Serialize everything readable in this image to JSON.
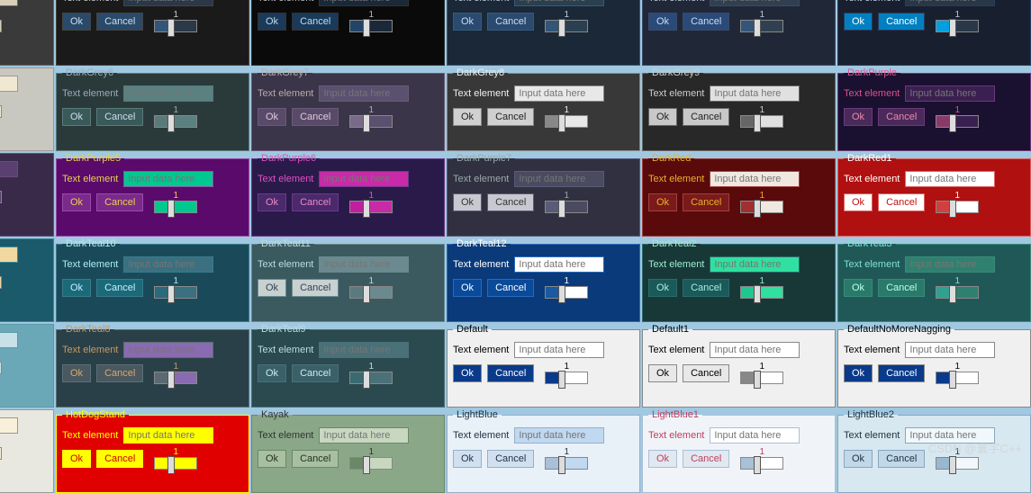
{
  "common": {
    "ok": "Ok",
    "cancel": "Cancel",
    "text_element": "Text element",
    "placeholder": "Input data here",
    "slider_value": "1"
  },
  "watermark": "CSDN @寰宇C++",
  "themes": [
    {
      "name": "",
      "bg": "#3a3a3a",
      "fg": "#ddd",
      "accent": "#0a0",
      "input_bg": "#d8d0b8",
      "input_fg": "#333",
      "btn_bg": "#555",
      "btn_fg": "#fff",
      "border": "#666"
    },
    {
      "name": "",
      "bg": "#1a1a1a",
      "fg": "#ccc",
      "accent": "#357",
      "input_bg": "#2a3848",
      "input_fg": "#aaccee",
      "btn_bg": "#2a4a6a",
      "btn_fg": "#cde",
      "border": "#444"
    },
    {
      "name": "",
      "bg": "#0a0a0a",
      "fg": "#bbb",
      "accent": "#246",
      "input_bg": "#1a2838",
      "input_fg": "#9bd",
      "btn_bg": "#1a3a5a",
      "btn_fg": "#bde",
      "border": "#333"
    },
    {
      "name": "",
      "bg": "#1a2838",
      "fg": "#bcd",
      "accent": "#357",
      "input_bg": "#2a4050",
      "input_fg": "#7ab0d8",
      "btn_bg": "#2a4a70",
      "btn_fg": "#cde",
      "border": "#3a5a7a"
    },
    {
      "name": "",
      "bg": "#202838",
      "fg": "#bcd",
      "accent": "#357",
      "input_bg": "#304050",
      "input_fg": "#9bd",
      "btn_bg": "#2a4a7a",
      "btn_fg": "#cde",
      "border": "#3a4a6a"
    },
    {
      "name": "",
      "bg": "#182030",
      "fg": "#bcd",
      "accent": "#00a0e0",
      "input_bg": "#283848",
      "input_fg": "#9bd",
      "btn_bg": "#0080c0",
      "btn_fg": "#fff",
      "border": "#2a3a5a"
    },
    {
      "name": "",
      "bg": "#c8c8c0",
      "fg": "#333",
      "accent": "#888",
      "input_bg": "#f0e8d0",
      "input_fg": "#333",
      "btn_bg": "#d8d8d0",
      "btn_fg": "#333",
      "border": "#999"
    },
    {
      "name": "DarkGrey6",
      "bg": "#2a3a3a",
      "fg": "#9ab",
      "accent": "#5a7a7a",
      "input_bg": "#5a8080",
      "input_fg": "#cde",
      "btn_bg": "#3a5a5a",
      "btn_fg": "#cde",
      "border": "#5a7a7a"
    },
    {
      "name": "DarkGrey7",
      "bg": "#3a3548",
      "fg": "#baa",
      "accent": "#7a6a8a",
      "input_bg": "#5a5070",
      "input_fg": "#dcd",
      "btn_bg": "#5a4a6a",
      "btn_fg": "#dcd",
      "border": "#6a5a7a"
    },
    {
      "name": "DarkGrey8",
      "bg": "#383838",
      "fg": "#eee",
      "accent": "#888",
      "input_bg": "#e8e8e8",
      "input_fg": "#222",
      "btn_bg": "#d0d0d0",
      "btn_fg": "#222",
      "border": "#888"
    },
    {
      "name": "DarkGrey9",
      "bg": "#282828",
      "fg": "#ccc",
      "accent": "#666",
      "input_bg": "#e0e0e0",
      "input_fg": "#222",
      "btn_bg": "#c8c8c8",
      "btn_fg": "#222",
      "border": "#666"
    },
    {
      "name": "DarkPurple",
      "bg": "#1a1030",
      "fg": "#e05090",
      "accent": "#8a3a6a",
      "input_bg": "#3a2050",
      "input_fg": "#d898c0",
      "btn_bg": "#4a2a5a",
      "btn_fg": "#e8a",
      "border": "#6a3a7a"
    },
    {
      "name": "",
      "bg": "#3a2a4a",
      "fg": "#cbd",
      "accent": "#7a5a8a",
      "input_bg": "#5a4070",
      "input_fg": "#dcd",
      "btn_bg": "#5a3a6a",
      "btn_fg": "#dcd",
      "border": "#6a4a7a"
    },
    {
      "name": "DarkPurple5",
      "bg": "#5a0a6a",
      "fg": "#e8d050",
      "accent": "#00c890",
      "input_bg": "#00c890",
      "input_fg": "#003020",
      "btn_bg": "#7a2a8a",
      "btn_fg": "#e8d050",
      "border": "#9a4aaa"
    },
    {
      "name": "DarkPurple6",
      "bg": "#2a1a4a",
      "fg": "#e050c0",
      "accent": "#c020a0",
      "input_bg": "#c82aa8",
      "input_fg": "#fce",
      "btn_bg": "#4a2a6a",
      "btn_fg": "#e8c",
      "border": "#6a3a8a"
    },
    {
      "name": "DarkPurple7",
      "bg": "#303040",
      "fg": "#9aa",
      "accent": "#5a5a7a",
      "input_bg": "#4a4a60",
      "input_fg": "#bcd",
      "btn_bg": "#c8c8d0",
      "btn_fg": "#333",
      "border": "#5a5a7a"
    },
    {
      "name": "DarkRed",
      "bg": "#5a0a0a",
      "fg": "#e8b030",
      "accent": "#a03030",
      "input_bg": "#f0e8e0",
      "input_fg": "#402",
      "btn_bg": "#7a1a1a",
      "btn_fg": "#e8b030",
      "border": "#a04040"
    },
    {
      "name": "DarkRed1",
      "bg": "#b01010",
      "fg": "#fff",
      "accent": "#d04040",
      "input_bg": "#fff",
      "input_fg": "#b01010",
      "btn_bg": "#fff",
      "btn_fg": "#c01010",
      "border": "#e06060"
    },
    {
      "name": "",
      "bg": "#1a5a6a",
      "fg": "#cef",
      "accent": "#2a7a8a",
      "input_bg": "#f0d8a0",
      "input_fg": "#332",
      "btn_bg": "#2a7a8a",
      "btn_fg": "#cef",
      "border": "#3a8a9a"
    },
    {
      "name": "DarkTeal10",
      "bg": "#1a4a5a",
      "fg": "#aee",
      "accent": "#2a6a7a",
      "input_bg": "#3a7080",
      "input_fg": "#cef",
      "btn_bg": "#1a6a7a",
      "btn_fg": "#cef",
      "border": "#3a7a8a"
    },
    {
      "name": "DarkTeal11",
      "bg": "#3a5a60",
      "fg": "#bdd",
      "accent": "#5a7a80",
      "input_bg": "#6a8a90",
      "input_fg": "#def",
      "btn_bg": "#c8d0d0",
      "btn_fg": "#345",
      "border": "#6a8a90"
    },
    {
      "name": "DarkTeal12",
      "bg": "#0a3a7a",
      "fg": "#fff",
      "accent": "#1a5aa0",
      "input_bg": "#fff",
      "input_fg": "#035",
      "btn_bg": "#0a4a9a",
      "btn_fg": "#fff",
      "border": "#2a6aba"
    },
    {
      "name": "DarkTeal2",
      "bg": "#183838",
      "fg": "#9ec",
      "accent": "#20c890",
      "input_bg": "#30e0a0",
      "input_fg": "#042",
      "btn_bg": "#1a5a5a",
      "btn_fg": "#aed",
      "border": "#2a6a6a"
    },
    {
      "name": "DarkTeal3",
      "bg": "#205858",
      "fg": "#80e0d0",
      "accent": "#30a090",
      "input_bg": "#308070",
      "input_fg": "#cfe",
      "btn_bg": "#2a7a6a",
      "btn_fg": "#bfe",
      "border": "#3a8a7a"
    },
    {
      "name": "",
      "bg": "#6aa8b8",
      "fg": "#fff",
      "accent": "#4a8a9a",
      "input_bg": "#c8e0e8",
      "input_fg": "#246",
      "btn_bg": "#4a8aa0",
      "btn_fg": "#fff",
      "border": "#5a98a8"
    },
    {
      "name": "DarkTeal8",
      "bg": "#2a4048",
      "fg": "#c89860",
      "accent": "#5a6a70",
      "input_bg": "#8a6ab0",
      "input_fg": "#ecd",
      "btn_bg": "#4a5860",
      "btn_fg": "#d8a870",
      "border": "#5a7078"
    },
    {
      "name": "DarkTeal9",
      "bg": "#2a4a50",
      "fg": "#bdd",
      "accent": "#3a6a70",
      "input_bg": "#4a7078",
      "input_fg": "#cee",
      "btn_bg": "#3a6068",
      "btn_fg": "#cee",
      "border": "#4a7078"
    },
    {
      "name": "Default",
      "bg": "#f0f0f0",
      "fg": "#000",
      "accent": "#0a3a8a",
      "input_bg": "#fff",
      "input_fg": "#000",
      "btn_bg": "#0a3a8a",
      "btn_fg": "#fff",
      "border": "#888",
      "btn2_bg": "#0a3a8a"
    },
    {
      "name": "Default1",
      "bg": "#f0f0f0",
      "fg": "#000",
      "accent": "#888",
      "input_bg": "#fff",
      "input_fg": "#000",
      "btn_bg": "#e8e8e8",
      "btn_fg": "#000",
      "border": "#888"
    },
    {
      "name": "DefaultNoMoreNagging",
      "bg": "#f0f0f0",
      "fg": "#000",
      "accent": "#0a3a8a",
      "input_bg": "#fff",
      "input_fg": "#000",
      "btn_bg": "#0a3a8a",
      "btn_fg": "#fff",
      "border": "#888"
    },
    {
      "name": "",
      "bg": "#e8e8e0",
      "fg": "#333",
      "accent": "#888",
      "input_bg": "#f8f0d8",
      "input_fg": "#333",
      "btn_bg": "#d8d8d0",
      "btn_fg": "#333",
      "border": "#999"
    },
    {
      "name": "HotDogStand",
      "bg": "#e00000",
      "fg": "#ffff00",
      "accent": "#ffff00",
      "input_bg": "#ffff00",
      "input_fg": "#000",
      "btn_bg": "#ffff00",
      "btn_fg": "#c00",
      "border": "#ffff00"
    },
    {
      "name": "Kayak",
      "bg": "#8aa888",
      "fg": "#333",
      "accent": "#6a8868",
      "input_bg": "#c8d8c0",
      "input_fg": "#232",
      "btn_bg": "#a8c0a0",
      "btn_fg": "#232",
      "border": "#6a8868"
    },
    {
      "name": "LightBlue",
      "bg": "#e8f0f8",
      "fg": "#234",
      "accent": "#a8c0d8",
      "input_bg": "#c0d8f0",
      "input_fg": "#234",
      "btn_bg": "#d0e0f0",
      "btn_fg": "#234",
      "border": "#98b0c8"
    },
    {
      "name": "LightBlue1",
      "bg": "#f0f4f8",
      "fg": "#c04060",
      "accent": "#a8c0d8",
      "input_bg": "#fff",
      "input_fg": "#333",
      "btn_bg": "#e0e8f0",
      "btn_fg": "#c04060",
      "border": "#a8c0d8"
    },
    {
      "name": "LightBlue2",
      "bg": "#d8e8f0",
      "fg": "#234",
      "accent": "#98b8d0",
      "input_bg": "#f0f8fc",
      "input_fg": "#234",
      "btn_bg": "#c0d8e8",
      "btn_fg": "#234",
      "border": "#88a8c0"
    }
  ]
}
